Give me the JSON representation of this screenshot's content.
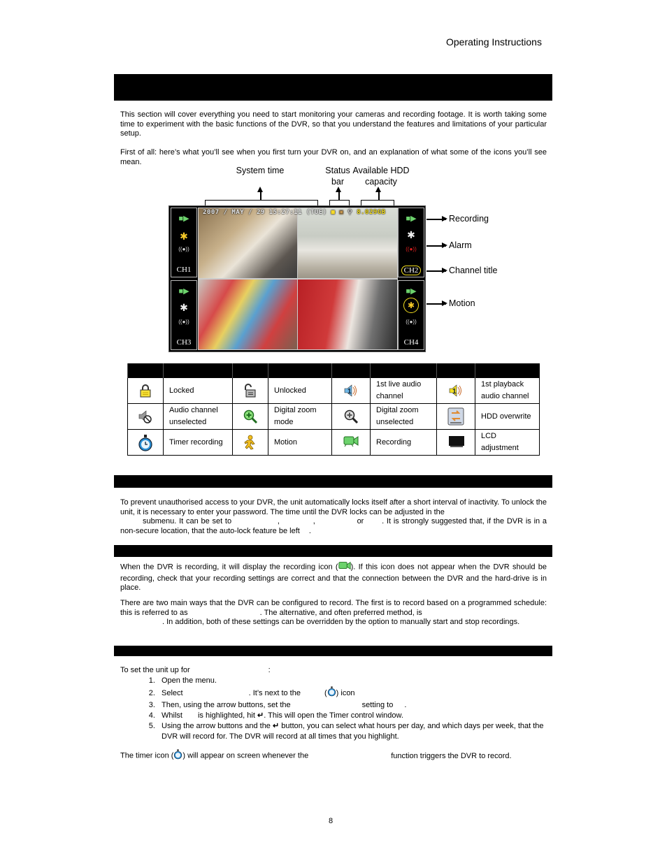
{
  "header": {
    "running_title": "Operating Instructions"
  },
  "intro": {
    "p1": "This section will cover everything you need to start monitoring your cameras and recording footage. It is worth taking some time to experiment with the basic functions of the DVR, so that you understand the features and limitations of your particular setup.",
    "p2": "First of all: here’s what you’ll see when you first turn your DVR on, and an explanation of what some of the icons you’ll see mean."
  },
  "screen_diagram": {
    "top_labels": [
      "System time",
      "Status bar",
      "Available HDD capacity"
    ],
    "side_labels": [
      "Recording",
      "Alarm",
      "Channel title",
      "Motion"
    ],
    "osd": {
      "datetime": "2007 / MAY / 29 15:27:11 (TUE)",
      "hdd": "8.029GB"
    },
    "channels": [
      "CH1",
      "CH2",
      "CH3",
      "CH4"
    ]
  },
  "icon_table": {
    "rows": [
      [
        {
          "icon": "lock-locked-icon",
          "label": "Locked"
        },
        {
          "icon": "lock-unlocked-icon",
          "label": "Unlocked"
        },
        {
          "icon": "live-audio-icon",
          "label": "1st live audio channel"
        },
        {
          "icon": "playback-audio-icon",
          "label": "1st playback audio channel"
        }
      ],
      [
        {
          "icon": "audio-unselected-icon",
          "label": "Audio channel unselected"
        },
        {
          "icon": "zoom-mode-icon",
          "label": "Digital zoom mode"
        },
        {
          "icon": "zoom-unselected-icon",
          "label": "Digital zoom unselected"
        },
        {
          "icon": "hdd-overwrite-icon",
          "label": "HDD overwrite"
        }
      ],
      [
        {
          "icon": "timer-icon",
          "label": "Timer recording"
        },
        {
          "icon": "motion-icon",
          "label": "Motion"
        },
        {
          "icon": "recording-icon",
          "label": "Recording"
        },
        {
          "icon": "lcd-icon",
          "label": "LCD adjustment"
        }
      ]
    ]
  },
  "lock_section": {
    "p1a": "To prevent unauthorised access to your DVR, the unit automatically locks itself after a short interval of inactivity. To unlock the unit, it is necessary to enter your password. The time until the DVR locks can be adjusted in the",
    "p1b": "submenu. It can be set to",
    "p1c": ",",
    "p1d": ",",
    "p1e": "or",
    "p1f": ". It is strongly suggested that, if the DVR is in a non-secure location, that the auto-lock feature be left",
    "p1g": "."
  },
  "record_section": {
    "p1a": "When the DVR is recording, it will display the recording icon (",
    "p1b": "). If this icon does not appear when the DVR should be recording, check that your recording settings are correct and that the connection between the DVR and the hard-drive is in place.",
    "p2a": "There are two main ways that the DVR can be configured to record. The first is to record based on a programmed schedule: this is referred to as",
    "p2b": ". The alternative, and often preferred method, is",
    "p2c": ". In addition, both of these settings can be overridden by the option to manually start and stop recordings."
  },
  "timer_section": {
    "intro": "To set the unit up for",
    "intro_end": ":",
    "steps": [
      "Open the menu.",
      "Select",
      "Then, using the arrow buttons, set the",
      "Whilst",
      "Using the arrow buttons and the"
    ],
    "step2_b": ". It’s next to the",
    "step2_c": ") icon",
    "step3_b": "setting to",
    "step3_c": ".",
    "step4_b": "is highlighted, hit",
    "step4_c": ". This will open the Timer control window.",
    "step5_b": "button, you can select what hours per day, and which days per week, that the DVR will record for. The DVR will record at all times that you highlight.",
    "footer_a": "The timer icon (",
    "footer_b": ") will appear on screen whenever the",
    "footer_c": "function triggers the DVR to record."
  },
  "footer": {
    "page_number": "8"
  }
}
